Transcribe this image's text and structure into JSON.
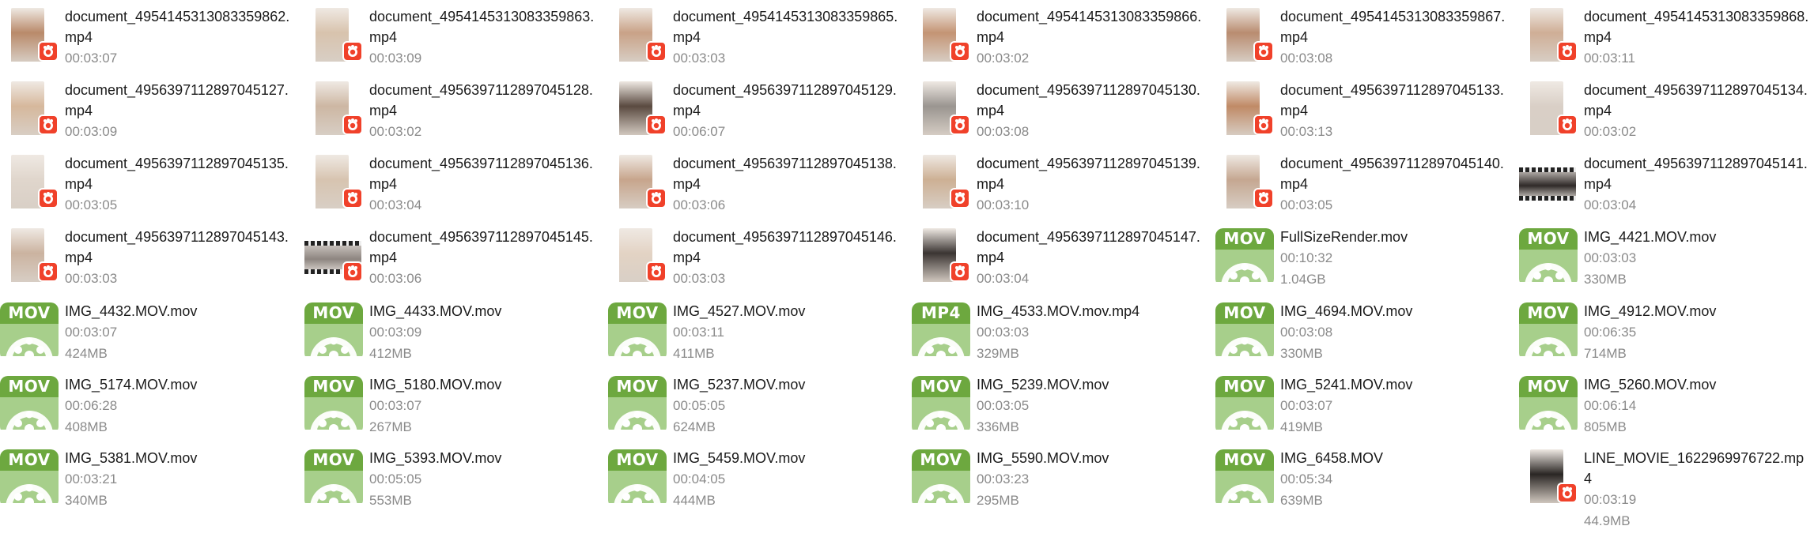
{
  "files": [
    {
      "name": "document_4954145313083359862.mp4",
      "duration": "00:03:07",
      "size": "",
      "thumb": "photo",
      "tone": "#b98a6a",
      "badge": true
    },
    {
      "name": "document_4954145313083359863.mp4",
      "duration": "00:03:09",
      "size": "",
      "thumb": "photo",
      "tone": "#d8c3ad",
      "badge": true
    },
    {
      "name": "document_4954145313083359865.mp4",
      "duration": "00:03:03",
      "size": "",
      "thumb": "photo",
      "tone": "#c9a287",
      "badge": true
    },
    {
      "name": "document_4954145313083359866.mp4",
      "duration": "00:03:02",
      "size": "",
      "thumb": "photo",
      "tone": "#c49474",
      "badge": true
    },
    {
      "name": "document_4954145313083359867.mp4",
      "duration": "00:03:08",
      "size": "",
      "thumb": "photo",
      "tone": "#b98c70",
      "badge": true
    },
    {
      "name": "document_4954145313083359868.mp4",
      "duration": "00:03:11",
      "size": "",
      "thumb": "photo",
      "tone": "#cfae96",
      "badge": true
    },
    {
      "name": "document_4956397112897045127.mp4",
      "duration": "00:03:09",
      "size": "",
      "thumb": "photo",
      "tone": "#d6b89c",
      "badge": true
    },
    {
      "name": "document_4956397112897045128.mp4",
      "duration": "00:03:02",
      "size": "",
      "thumb": "photo",
      "tone": "#cdb7a3",
      "badge": true
    },
    {
      "name": "document_4956397112897045129.mp4",
      "duration": "00:06:07",
      "size": "",
      "thumb": "photo",
      "tone": "#5a4a40",
      "badge": true
    },
    {
      "name": "document_4956397112897045130.mp4",
      "duration": "00:03:08",
      "size": "",
      "thumb": "photo",
      "tone": "#9a9590",
      "badge": true
    },
    {
      "name": "document_4956397112897045133.mp4",
      "duration": "00:03:13",
      "size": "",
      "thumb": "photo",
      "tone": "#c08a66",
      "badge": true
    },
    {
      "name": "document_4956397112897045134.mp4",
      "duration": "00:03:02",
      "size": "",
      "thumb": "photo",
      "tone": "#d9cfc6",
      "badge": true
    },
    {
      "name": "document_4956397112897045135.mp4",
      "duration": "00:03:05",
      "size": "",
      "thumb": "photo",
      "tone": "#e0d6cc",
      "badge": true
    },
    {
      "name": "document_4956397112897045136.mp4",
      "duration": "00:03:04",
      "size": "",
      "thumb": "photo",
      "tone": "#d7c4b0",
      "badge": true
    },
    {
      "name": "document_4956397112897045138.mp4",
      "duration": "00:03:06",
      "size": "",
      "thumb": "photo",
      "tone": "#c7a58c",
      "badge": true
    },
    {
      "name": "document_4956397112897045139.mp4",
      "duration": "00:03:10",
      "size": "",
      "thumb": "photo",
      "tone": "#cdb094",
      "badge": true
    },
    {
      "name": "document_4956397112897045140.mp4",
      "duration": "00:03:05",
      "size": "",
      "thumb": "photo",
      "tone": "#c5a791",
      "badge": true
    },
    {
      "name": "document_4956397112897045141.mp4",
      "duration": "00:03:04",
      "size": "",
      "thumb": "film",
      "tone": "#2f2a28",
      "badge": false
    },
    {
      "name": "document_4956397112897045143.mp4",
      "duration": "00:03:03",
      "size": "",
      "thumb": "photo",
      "tone": "#cbb3a0",
      "badge": true
    },
    {
      "name": "document_4956397112897045145.mp4",
      "duration": "00:03:06",
      "size": "",
      "thumb": "film",
      "tone": "#8d8580",
      "badge": true
    },
    {
      "name": "document_4956397112897045146.mp4",
      "duration": "00:03:03",
      "size": "",
      "thumb": "photo",
      "tone": "#e3d3c4",
      "badge": true
    },
    {
      "name": "document_4956397112897045147.mp4",
      "duration": "00:03:04",
      "size": "",
      "thumb": "photo",
      "tone": "#3b3533",
      "badge": true
    },
    {
      "name": "FullSizeRender.mov",
      "duration": "00:10:32",
      "size": "1.04GB",
      "thumb": "icon",
      "type": "MOV"
    },
    {
      "name": "IMG_4421.MOV.mov",
      "duration": "00:03:03",
      "size": "330MB",
      "thumb": "icon",
      "type": "MOV"
    },
    {
      "name": "IMG_4432.MOV.mov",
      "duration": "00:03:07",
      "size": "424MB",
      "thumb": "icon",
      "type": "MOV"
    },
    {
      "name": "IMG_4433.MOV.mov",
      "duration": "00:03:09",
      "size": "412MB",
      "thumb": "icon",
      "type": "MOV"
    },
    {
      "name": "IMG_4527.MOV.mov",
      "duration": "00:03:11",
      "size": "411MB",
      "thumb": "icon",
      "type": "MOV"
    },
    {
      "name": "IMG_4533.MOV.mov.mp4",
      "duration": "00:03:03",
      "size": "329MB",
      "thumb": "icon",
      "type": "MP4"
    },
    {
      "name": "IMG_4694.MOV.mov",
      "duration": "00:03:08",
      "size": "330MB",
      "thumb": "icon",
      "type": "MOV"
    },
    {
      "name": "IMG_4912.MOV.mov",
      "duration": "00:06:35",
      "size": "714MB",
      "thumb": "icon",
      "type": "MOV"
    },
    {
      "name": "IMG_5174.MOV.mov",
      "duration": "00:06:28",
      "size": "408MB",
      "thumb": "icon",
      "type": "MOV"
    },
    {
      "name": "IMG_5180.MOV.mov",
      "duration": "00:03:07",
      "size": "267MB",
      "thumb": "icon",
      "type": "MOV"
    },
    {
      "name": "IMG_5237.MOV.mov",
      "duration": "00:05:05",
      "size": "624MB",
      "thumb": "icon",
      "type": "MOV"
    },
    {
      "name": "IMG_5239.MOV.mov",
      "duration": "00:03:05",
      "size": "336MB",
      "thumb": "icon",
      "type": "MOV"
    },
    {
      "name": "IMG_5241.MOV.mov",
      "duration": "00:03:07",
      "size": "419MB",
      "thumb": "icon",
      "type": "MOV"
    },
    {
      "name": "IMG_5260.MOV.mov",
      "duration": "00:06:14",
      "size": "805MB",
      "thumb": "icon",
      "type": "MOV"
    },
    {
      "name": "IMG_5381.MOV.mov",
      "duration": "00:03:21",
      "size": "340MB",
      "thumb": "icon",
      "type": "MOV"
    },
    {
      "name": "IMG_5393.MOV.mov",
      "duration": "00:05:05",
      "size": "553MB",
      "thumb": "icon",
      "type": "MOV"
    },
    {
      "name": "IMG_5459.MOV.mov",
      "duration": "00:04:05",
      "size": "444MB",
      "thumb": "icon",
      "type": "MOV"
    },
    {
      "name": "IMG_5590.MOV.mov",
      "duration": "00:03:23",
      "size": "295MB",
      "thumb": "icon",
      "type": "MOV"
    },
    {
      "name": "IMG_6458.MOV",
      "duration": "00:05:34",
      "size": "639MB",
      "thumb": "icon",
      "type": "MOV"
    },
    {
      "name": "LINE_MOVIE_1622969976722.mp4",
      "duration": "00:03:19",
      "size": "44.9MB",
      "thumb": "photo",
      "tone": "#2a2624",
      "badge": true
    }
  ]
}
